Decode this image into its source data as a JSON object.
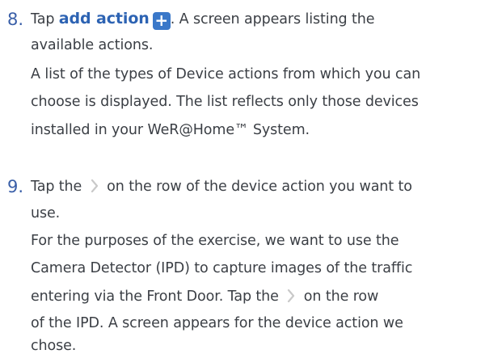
{
  "step8": {
    "number": "8.",
    "line1_pre": "Tap ",
    "action_label": "add action",
    "plus_glyph": "+",
    "line1_post": ". A screen appears listing the",
    "line2": "available actions.",
    "line3": "A list of the types of Device actions from which you can",
    "line4": "choose is displayed. The list reflects only those devices",
    "line5": "installed in your WeR@Home™ System."
  },
  "step9": {
    "number": "9.",
    "line1_pre": "Tap the ",
    "line1_post": " on the row of the device action you want to",
    "line2": "use.",
    "line3": "For the purposes of the exercise, we want to use the",
    "line4": "Camera Detector (IPD) to capture images of the traffic",
    "line5_pre": "entering via the Front Door. Tap the ",
    "line5_post": " on the row",
    "line6": "of the IPD. A screen appears for the device action we",
    "line7": "chose."
  },
  "colors": {
    "accent": "#2d63b3",
    "plus_button": "#3a78c9",
    "text": "#3b3f45",
    "chevron": "#c9c9c9"
  },
  "icons": {
    "plus": "plus-icon",
    "chevron": "chevron-right-icon"
  }
}
